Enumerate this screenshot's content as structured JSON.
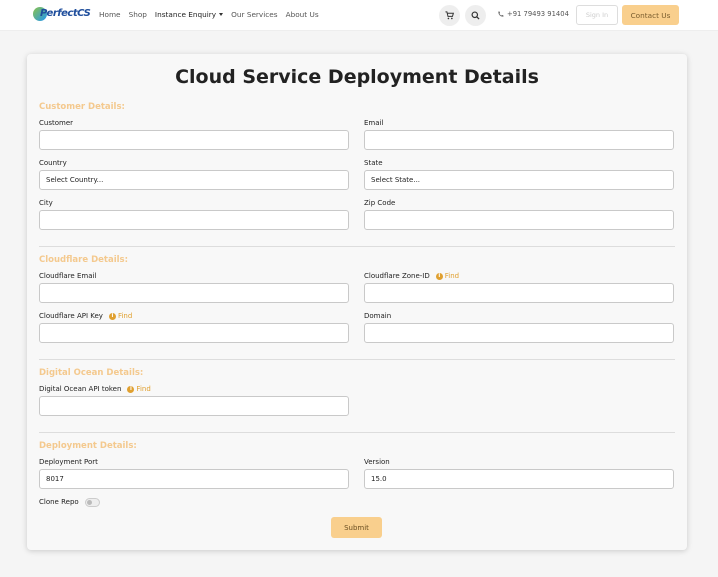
{
  "nav": {
    "logo_text": "PerfectCS",
    "links": [
      "Home",
      "Shop",
      "Instance Enquiry",
      "Our Services",
      "About Us"
    ],
    "phone": "+91 79493 91404",
    "sign_in": "Sign In",
    "contact": "Contact Us",
    "icons": {
      "cart": "cart-icon",
      "search": "search-icon",
      "phone": "phone-icon"
    }
  },
  "page": {
    "title": "Cloud Service Deployment Details"
  },
  "customer": {
    "section_title": "Customer Details:",
    "customer_label": "Customer",
    "email_label": "Email",
    "country_label": "Country",
    "country_value": "Select Country...",
    "state_label": "State",
    "state_value": "Select State...",
    "city_label": "City",
    "zip_label": "Zip Code"
  },
  "cloudflare": {
    "section_title": "Cloudflare Details:",
    "email_label": "Cloudflare Email",
    "zone_label": "Cloudflare Zone-ID",
    "api_key_label": "Cloudflare API Key",
    "domain_label": "Domain",
    "find_label": "Find"
  },
  "digital_ocean": {
    "section_title": "Digital Ocean Details:",
    "token_label": "Digital Ocean API token",
    "find_label": "Find"
  },
  "deployment": {
    "section_title": "Deployment Details:",
    "port_label": "Deployment Port",
    "port_value": "8017",
    "version_label": "Version",
    "version_value": "15.0",
    "clone_label": "Clone Repo",
    "clone_enabled": false,
    "submit_label": "Submit"
  },
  "colors": {
    "accent": "#f9cf8d",
    "section_title": "#f4c98e",
    "find": "#e0a030"
  }
}
